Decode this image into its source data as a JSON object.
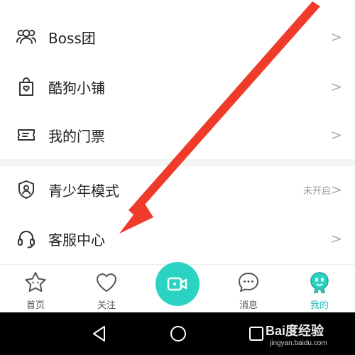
{
  "menu": {
    "items": [
      {
        "label": "Boss团",
        "icon": "group-icon"
      },
      {
        "label": "酷狗小铺",
        "icon": "shop-bag-icon"
      },
      {
        "label": "我的门票",
        "icon": "ticket-icon"
      },
      {
        "label": "青少年模式",
        "icon": "shield-user-icon",
        "status": "未开启"
      },
      {
        "label": "客服中心",
        "icon": "headset-icon"
      }
    ],
    "chevron": ">"
  },
  "tabbar": {
    "tabs": [
      {
        "label": "首页",
        "icon": "star-icon"
      },
      {
        "label": "关注",
        "icon": "heart-icon"
      },
      {
        "label": "消息",
        "icon": "chat-bubble-icon"
      },
      {
        "label": "我的",
        "icon": "mascot-icon"
      }
    ],
    "active_color": "#26c6b4",
    "center_button_color": "#2bd4c2"
  },
  "watermark": {
    "main": "Bai度经验",
    "sub": "jingyan.baidu.com"
  },
  "annotation_color": "#f03a2a"
}
